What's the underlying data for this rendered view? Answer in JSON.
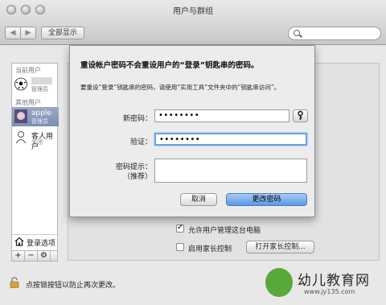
{
  "window": {
    "title": "用户与群组"
  },
  "toolbar": {
    "back": "◀",
    "forward": "▶",
    "show_all": "全部显示",
    "search_placeholder": ""
  },
  "sidebar": {
    "section_current": "当前用户",
    "current_user": {
      "name": "",
      "role": "管理员"
    },
    "section_other": "其他用户",
    "users": [
      {
        "name": "apple",
        "role": "管理员"
      },
      {
        "name": "客人用户",
        "role": "关闭"
      }
    ],
    "login_options": "登录选项",
    "add": "+",
    "remove": "−",
    "action": "⚙"
  },
  "dialog": {
    "title": "重设帐户密码不会重设用户的“登录”钥匙串的密码。",
    "description": "要重设“登录”钥匙串的密码，请使用“实用工具”文件夹中的“钥匙串访问”。",
    "new_password_label": "新密码：",
    "new_password_value": "••••••••",
    "verify_label": "验证：",
    "verify_value": "••••••••",
    "hint_label": "密码提示：",
    "hint_sub": "（推荐）",
    "hint_value": "",
    "cancel": "取消",
    "change": "更改密码"
  },
  "panel": {
    "allow_admin": "允许用户管理这台电脑",
    "allow_admin_checked": true,
    "parental": "启用家长控制",
    "parental_checked": false,
    "open_parental": "打开家长控制..."
  },
  "footer": {
    "lock_text": "点按锁按钮以防止再次更改。"
  },
  "watermark": {
    "text": "幼儿教育网",
    "url": "www.jy135.com"
  }
}
